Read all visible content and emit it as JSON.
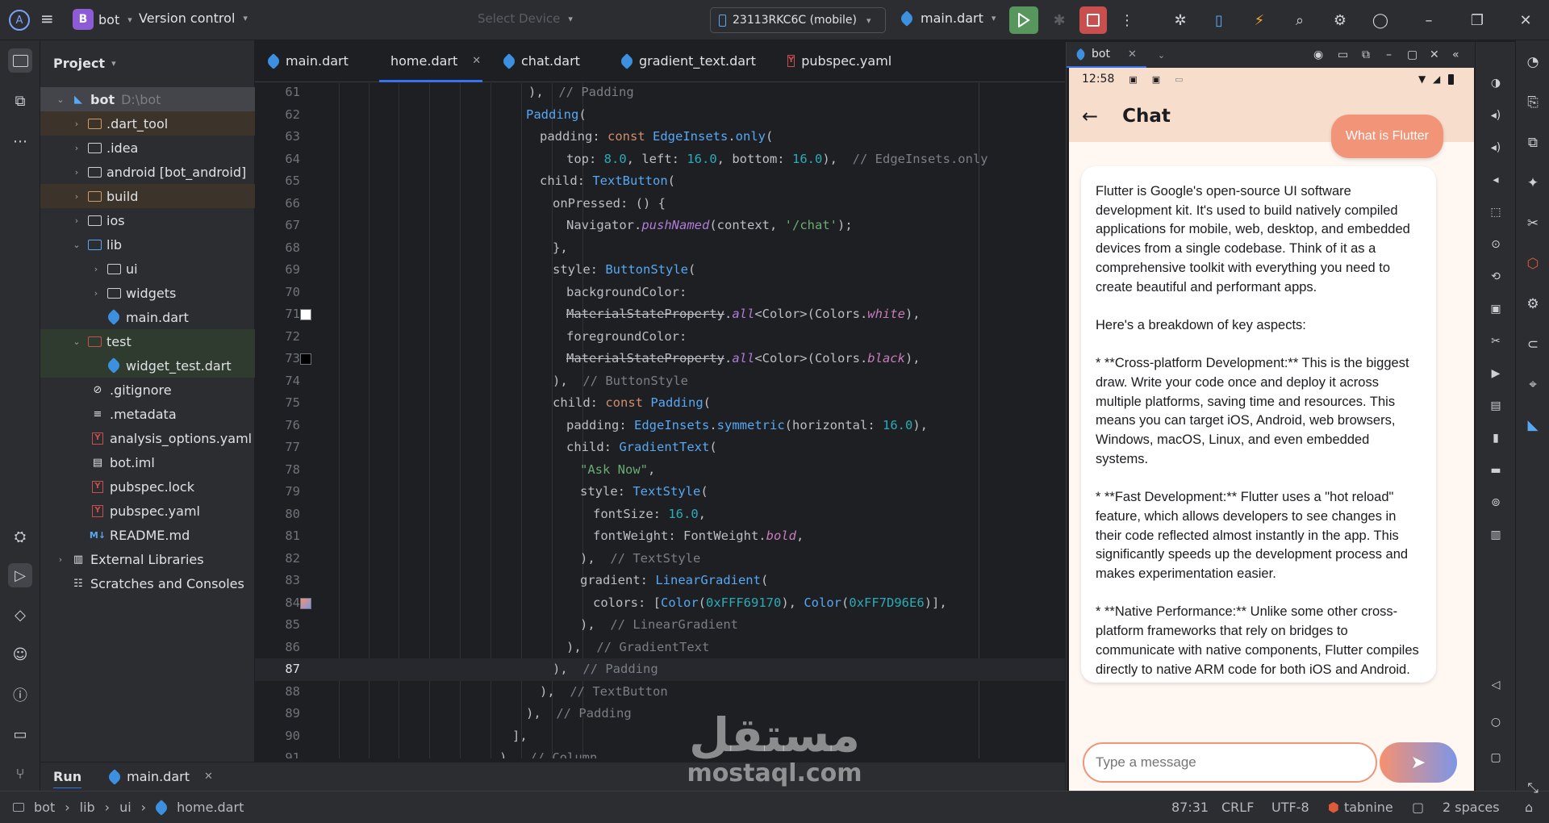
{
  "topbar": {
    "project_initial": "B",
    "project_name": "bot",
    "version_control": "Version control",
    "select_device": "Select Device",
    "device": "23113RKC6C (mobile)",
    "run_config": "main.dart"
  },
  "project_panel": {
    "title": "Project",
    "root_name": "bot",
    "root_path": "D:\\bot",
    "items": [
      {
        "label": ".dart_tool"
      },
      {
        "label": ".idea"
      },
      {
        "label": "android [bot_android]"
      },
      {
        "label": "build"
      },
      {
        "label": "ios"
      },
      {
        "label": "lib"
      },
      {
        "label": "ui"
      },
      {
        "label": "widgets"
      },
      {
        "label": "main.dart"
      },
      {
        "label": "test"
      },
      {
        "label": "widget_test.dart"
      },
      {
        "label": ".gitignore"
      },
      {
        "label": ".metadata"
      },
      {
        "label": "analysis_options.yaml"
      },
      {
        "label": "bot.iml"
      },
      {
        "label": "pubspec.lock"
      },
      {
        "label": "pubspec.yaml"
      },
      {
        "label": "README.md"
      },
      {
        "label": "External Libraries"
      },
      {
        "label": "Scratches and Consoles"
      }
    ]
  },
  "tabs": [
    {
      "label": "main.dart"
    },
    {
      "label": "home.dart"
    },
    {
      "label": "chat.dart"
    },
    {
      "label": "gradient_text.dart"
    },
    {
      "label": "pubspec.yaml"
    }
  ],
  "editor": {
    "current_line": 87,
    "line_numbers": [
      "61",
      "62",
      "63",
      "64",
      "65",
      "66",
      "67",
      "68",
      "69",
      "70",
      "71",
      "72",
      "73",
      "74",
      "75",
      "76",
      "77",
      "78",
      "79",
      "80",
      "81",
      "82",
      "83",
      "84",
      "85",
      "86",
      "87",
      "88",
      "89",
      "90",
      "91"
    ],
    "code": {
      "l61a": "),",
      "l61b": "// Padding",
      "l62a": "Padding",
      "l62b": "(",
      "l63a": "padding: ",
      "l63b": "const ",
      "l63c": "EdgeInsets",
      "l63d": ".",
      "l63e": "only",
      "l63f": "(",
      "l64a": "top: ",
      "l64b": "8.0",
      "l64c": ", left: ",
      "l64d": "16.0",
      "l64e": ", bottom: ",
      "l64f": "16.0",
      "l64g": "),",
      "l64h": "// EdgeInsets.only",
      "l65a": "child: ",
      "l65b": "TextButton",
      "l65c": "(",
      "l66a": "onPressed: () {",
      "l67a": "Navigator.",
      "l67b": "pushNamed",
      "l67c": "(context, ",
      "l67d": "'/chat'",
      "l67e": ");",
      "l68a": "},",
      "l69a": "style: ",
      "l69b": "ButtonStyle",
      "l69c": "(",
      "l70a": "backgroundColor:",
      "l71a": "MaterialStateProperty",
      "l71b": ".",
      "l71c": "all",
      "l71d": "<Color>(Colors.",
      "l71e": "white",
      "l71f": "),",
      "l72a": "foregroundColor:",
      "l73a": "MaterialStateProperty",
      "l73b": ".",
      "l73c": "all",
      "l73d": "<Color>(Colors.",
      "l73e": "black",
      "l73f": "),",
      "l74a": "),",
      "l74b": "// ButtonStyle",
      "l75a": "child: ",
      "l75b": "const ",
      "l75c": "Padding",
      "l75d": "(",
      "l76a": "padding: ",
      "l76b": "EdgeInsets",
      "l76c": ".",
      "l76d": "symmetric",
      "l76e": "(horizontal: ",
      "l76f": "16.0",
      "l76g": "),",
      "l77a": "child: ",
      "l77b": "GradientText",
      "l77c": "(",
      "l78a": "\"Ask Now\"",
      "l78b": ",",
      "l79a": "style: ",
      "l79b": "TextStyle",
      "l79c": "(",
      "l80a": "fontSize: ",
      "l80b": "16.0",
      "l80c": ",",
      "l81a": "fontWeight: FontWeight.",
      "l81b": "bold",
      "l81c": ",",
      "l82a": "),",
      "l82b": "// TextStyle",
      "l83a": "gradient: ",
      "l83b": "LinearGradient",
      "l83c": "(",
      "l84a": "colors: [",
      "l84b": "Color",
      "l84c": "(",
      "l84d": "0xFFF69170",
      "l84e": "), ",
      "l84f": "Color",
      "l84g": "(",
      "l84h": "0xFF7D96E6",
      "l84i": ")],",
      "l85a": "),",
      "l85b": "// LinearGradient",
      "l86a": "),",
      "l86b": "// GradientText",
      "l87a": "),",
      "l87b": "// Padding",
      "l88a": "),",
      "l88b": "// TextButton",
      "l89a": "),",
      "l89b": "// Padding",
      "l90a": "],",
      "l91a": "),",
      "l91b": "// Column"
    },
    "swatches": {
      "l71": "#ffffff",
      "l73": "#000000",
      "l84_from": "#F69170",
      "l84_to": "#7D96E6"
    }
  },
  "run_bar": {
    "label": "Run",
    "config": "main.dart"
  },
  "statusbar": {
    "breadcrumb": [
      "bot",
      "lib",
      "ui",
      "home.dart"
    ],
    "position": "87:31",
    "line_sep": "CRLF",
    "encoding": "UTF-8",
    "plugin": "tabnine",
    "indent": "2 spaces"
  },
  "emulator": {
    "tab_label": "bot",
    "phone": {
      "time": "12:58",
      "app_title": "Chat",
      "user_message": "What is Flutter",
      "bot_paragraphs": [
        "Flutter is Google's open-source UI software development kit. It's used to build natively compiled applications for mobile, web, desktop, and embedded devices from a single codebase.  Think of it as a comprehensive toolkit with everything you need to create beautiful and performant apps.",
        "Here's a breakdown of key aspects:",
        "* **Cross-platform Development:** This is the biggest draw. Write your code once and deploy it across multiple platforms, saving time and resources.  This means you can target iOS, Android, web browsers, Windows, macOS, Linux, and even embedded systems.",
        "* **Fast Development:** Flutter uses a \"hot reload\" feature, which allows developers to see changes in their code reflected almost instantly in the app. This significantly speeds up the development process and makes experimentation easier.",
        "* **Native Performance:** Unlike some other cross-platform frameworks that rely on bridges to communicate with native components, Flutter compiles directly to native ARM code for both iOS and Android. This results in performance that's close to, and sometimes even indistinguishable from, truly native"
      ],
      "input_placeholder": "Type a message"
    }
  },
  "watermark": {
    "arabic": "مستقل",
    "latin": "mostaql.com"
  },
  "colors": {
    "accent": "#3574f0",
    "run": "#57965c",
    "stop": "#c94f4f",
    "user_bubble": "#f29477",
    "gradient_from": "#F69170",
    "gradient_to": "#7D96E6"
  }
}
